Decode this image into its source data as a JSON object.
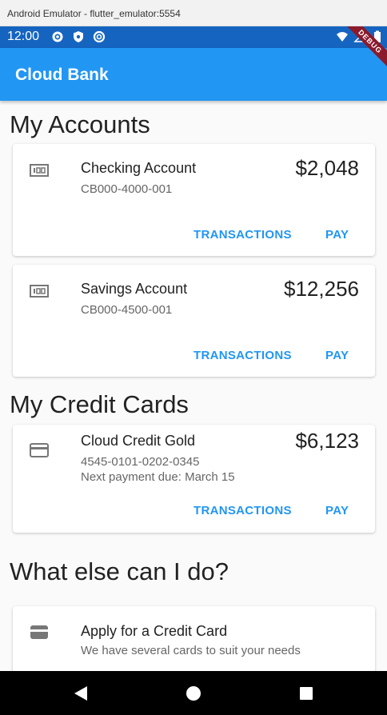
{
  "window": {
    "title": "Android Emulator - flutter_emulator:5554"
  },
  "status_bar": {
    "time": "12:00",
    "icons": [
      "gear-icon",
      "shield-icon",
      "circle-icon"
    ],
    "right_icons": [
      "wifi-icon",
      "signal-icon",
      "battery-icon"
    ]
  },
  "debug_banner": "DEBUG",
  "app_bar": {
    "title": "Cloud Bank"
  },
  "accounts_section": {
    "title": "My Accounts",
    "accounts": [
      {
        "name": "Checking Account",
        "number": "CB000-4000-001",
        "balance": "$2,048",
        "icon": "bank-account-icon",
        "transactions_label": "TRANSACTIONS",
        "pay_label": "PAY"
      },
      {
        "name": "Savings Account",
        "number": "CB000-4500-001",
        "balance": "$12,256",
        "icon": "bank-account-icon",
        "transactions_label": "TRANSACTIONS",
        "pay_label": "PAY"
      }
    ]
  },
  "credit_section": {
    "title": "My Credit Cards",
    "cards": [
      {
        "name": "Cloud Credit Gold",
        "number": "4545-0101-0202-0345",
        "due": "Next payment due: March 15",
        "balance": "$6,123",
        "icon": "credit-card-icon",
        "transactions_label": "TRANSACTIONS",
        "pay_label": "PAY"
      }
    ]
  },
  "else_section": {
    "title": "What else can I do?",
    "items": [
      {
        "name": "Apply for a Credit Card",
        "description": "We have several cards to suit your needs",
        "icon": "wallet-icon"
      }
    ]
  },
  "nav_bar": {
    "buttons": [
      "back-icon",
      "home-icon",
      "recents-icon"
    ]
  },
  "colors": {
    "primary": "#2196f3",
    "status_bar": "#1565c0",
    "debug": "#8b1a2b"
  }
}
